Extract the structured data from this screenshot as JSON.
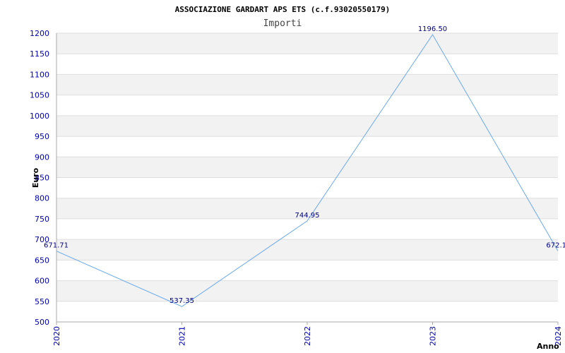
{
  "chart_data": {
    "type": "line",
    "title": "ASSOCIAZIONE GARDART APS ETS (c.f.93020550179)",
    "subtitle": "Importi",
    "xlabel": "Anno",
    "ylabel": "Euro",
    "categories": [
      "2020",
      "2021",
      "2022",
      "2023",
      "2024"
    ],
    "series": [
      {
        "values": [
          671.71,
          537.35,
          744.95,
          1196.5,
          672.1
        ]
      }
    ],
    "data_labels": [
      "671.71",
      "537.35",
      "744.95",
      "1196.50",
      "672.1"
    ],
    "ylim": [
      500,
      1200
    ],
    "ytick_step": 50,
    "grid": true,
    "line_color": "#6aaaf0",
    "band_color": "#f2f2f2",
    "grid_color": "#dddddd",
    "tick_color": "#0000aa"
  }
}
